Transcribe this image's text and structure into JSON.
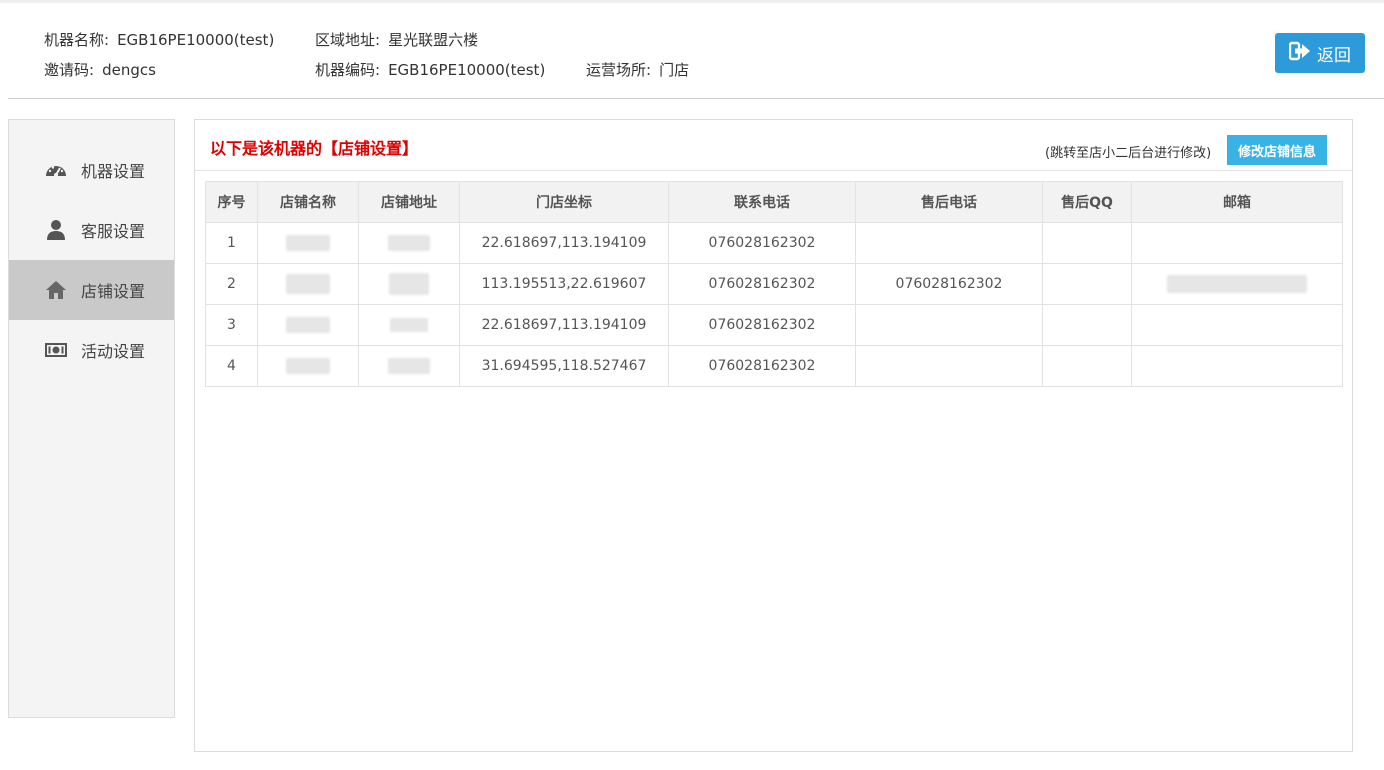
{
  "header": {
    "machine_name_label": "机器名称:",
    "machine_name": "EGB16PE10000(test)",
    "region_label": "区域地址:",
    "region": "星光联盟六楼",
    "invite_label": "邀请码:",
    "invite_code": "dengcs",
    "machine_code_label": "机器编码:",
    "machine_code": "EGB16PE10000(test)",
    "venue_label": "运营场所:",
    "venue": "门店",
    "back_label": "返回"
  },
  "sidebar": {
    "items": [
      {
        "label": "机器设置",
        "icon": "dashboard-icon"
      },
      {
        "label": "客服设置",
        "icon": "user-icon"
      },
      {
        "label": "店铺设置",
        "icon": "home-icon",
        "active": true
      },
      {
        "label": "活动设置",
        "icon": "money-icon"
      }
    ]
  },
  "panel": {
    "title": "以下是该机器的【店铺设置】",
    "note": "(跳转至店小二后台进行修改)",
    "edit_label": "修改店铺信息"
  },
  "table": {
    "headers": [
      "序号",
      "店铺名称",
      "店铺地址",
      "门店坐标",
      "联系电话",
      "售后电话",
      "售后QQ",
      "邮箱"
    ],
    "rows": [
      {
        "index": "1",
        "coords": "22.618697,113.194109",
        "phone": "076028162302",
        "after_phone": "",
        "qq": ""
      },
      {
        "index": "2",
        "coords": "113.195513,22.619607",
        "phone": "076028162302",
        "after_phone": "076028162302",
        "qq": ""
      },
      {
        "index": "3",
        "coords": "22.618697,113.194109",
        "phone": "076028162302",
        "after_phone": "",
        "qq": ""
      },
      {
        "index": "4",
        "coords": "31.694595,118.527467",
        "phone": "076028162302",
        "after_phone": "",
        "qq": ""
      }
    ]
  },
  "colors": {
    "accent": "#2d9ad9",
    "edit_button": "#39b3e6",
    "title_red": "#e00000",
    "sidebar_active": "#c9c9c9"
  }
}
